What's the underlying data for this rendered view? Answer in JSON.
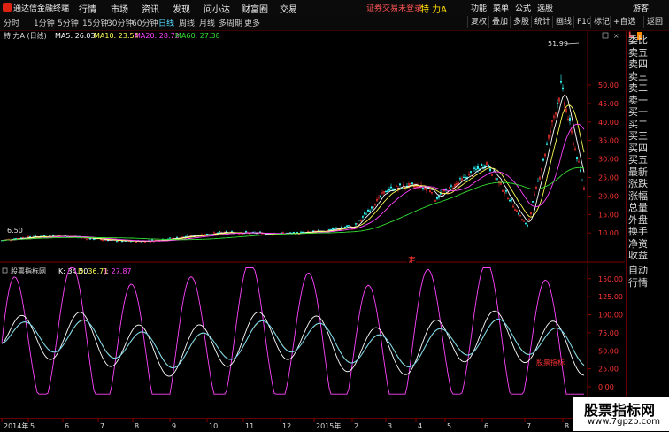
{
  "menubar": {
    "app_title": "通达信金融终端",
    "items": [
      "行情",
      "市场",
      "资讯",
      "发现",
      "问小达",
      "财富圈",
      "交易"
    ],
    "login_status": "证券交易未登录",
    "stock_name": "特 力A",
    "right_items": [
      "功能",
      "菜单",
      "公式",
      "选股",
      "游客"
    ]
  },
  "toolbar": {
    "periods": [
      "分时",
      "1分钟",
      "5分钟",
      "15分钟",
      "30分钟",
      "60分钟",
      "日线",
      "周线",
      "月线",
      "多周期",
      "更多"
    ],
    "active_period": "日线",
    "buttons": [
      "复权",
      "叠加",
      "多股",
      "统计",
      "画线",
      "F10",
      "标记",
      "+自选",
      "返回"
    ]
  },
  "main": {
    "header": {
      "name": "特 力A (日线)",
      "ma5": "MA5: 26.03",
      "ma10": "MA10: 23.54",
      "ma20": "MA20: 28.72",
      "ma60": "MA60: 27.38"
    },
    "high_label": "51.99",
    "low_label": "6.50",
    "marker": "定",
    "y_ticks": [
      "50.00",
      "45.00",
      "40.00",
      "35.00",
      "30.00",
      "25.00",
      "20.00",
      "15.00",
      "10.00"
    ],
    "colors": {
      "ma5": "#ffffff",
      "ma10": "#ffff55",
      "ma20": "#ff44ff",
      "ma60": "#33dd33",
      "up": "#ff3333",
      "down": "#33ffff"
    }
  },
  "kdj": {
    "header": {
      "name": "股票指标网",
      "k": "K: 34.50",
      "d": "D: 36.71",
      "j": "J: 27.87"
    },
    "annotation": "股票指标",
    "y_ticks": [
      "150.00",
      "125.00",
      "100.00",
      "75.00",
      "50.00",
      "25.00",
      "0.00"
    ]
  },
  "date_axis": {
    "labels": [
      "2014年",
      "5",
      "6",
      "7",
      "8",
      "9",
      "10",
      "11",
      "12",
      "2015年",
      "2",
      "3",
      "4",
      "5",
      "6",
      "7",
      "8"
    ]
  },
  "right_panel": {
    "top_label": "L",
    "items": [
      "委比",
      "卖五",
      "卖四",
      "卖三",
      "卖二",
      "卖一",
      "买一",
      "买二",
      "买三",
      "买四",
      "买五",
      "最新",
      "涨跌",
      "涨幅",
      "总量",
      "外盘",
      "换手",
      "净资",
      "收益",
      "自动",
      "行情"
    ]
  },
  "watermark": {
    "title": "股票指标网",
    "url": "www.7gpzb.com"
  }
}
